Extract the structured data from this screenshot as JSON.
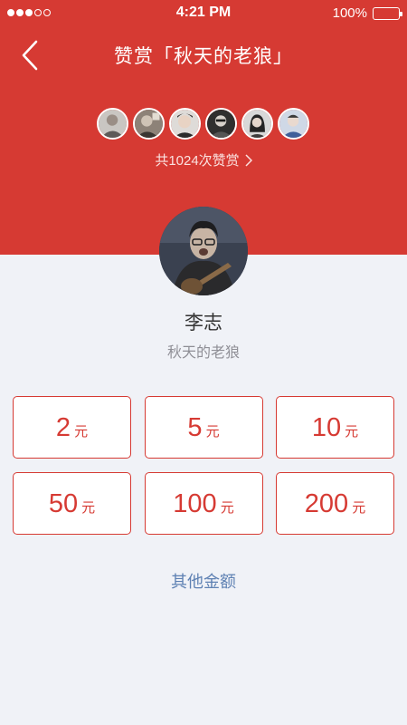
{
  "status_bar": {
    "time": "4:21 PM",
    "battery": "100%",
    "signal_dots": [
      true,
      true,
      true,
      false,
      false
    ]
  },
  "nav": {
    "title": "赞赏「秋天的老狼」"
  },
  "supporters": {
    "avatars": [
      "supporter-avatar-1",
      "supporter-avatar-2",
      "supporter-avatar-3",
      "supporter-avatar-4",
      "supporter-avatar-5",
      "supporter-avatar-6"
    ],
    "total_text": "共1024次赞赏"
  },
  "user": {
    "name": "李志",
    "subtitle": "秋天的老狼"
  },
  "amounts": [
    {
      "value": "2",
      "unit": "元"
    },
    {
      "value": "5",
      "unit": "元"
    },
    {
      "value": "10",
      "unit": "元"
    },
    {
      "value": "50",
      "unit": "元"
    },
    {
      "value": "100",
      "unit": "元"
    },
    {
      "value": "200",
      "unit": "元"
    }
  ],
  "other_amount_label": "其他金额",
  "colors": {
    "brand_red": "#d63a33",
    "background": "#f0f2f7",
    "link_blue": "#5e81b3"
  }
}
